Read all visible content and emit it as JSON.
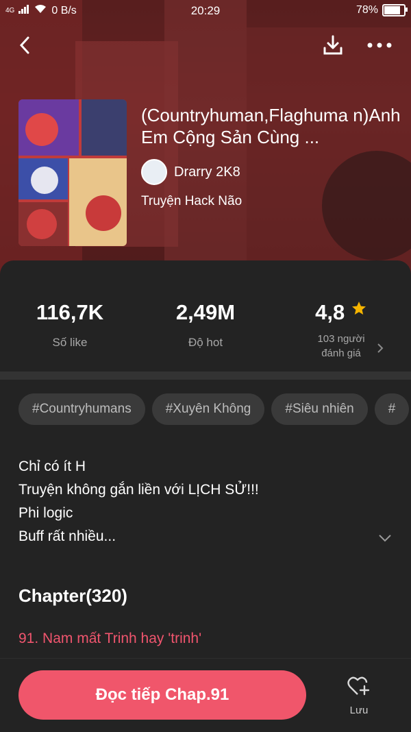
{
  "status_bar": {
    "network": "4G",
    "speed": "0 B/s",
    "time": "20:29",
    "battery": "78%"
  },
  "comic": {
    "title": "(Countryhuman,Flaghuma n)Anh Em Cộng Sản Cùng ...",
    "author": "Drarry 2K8",
    "genre": "Truyện Hack Não"
  },
  "stats": {
    "likes": {
      "value": "116,7K",
      "label": "Số like"
    },
    "hot": {
      "value": "2,49M",
      "label": "Độ hot"
    },
    "rating": {
      "value": "4,8",
      "label_line1": "103 người",
      "label_line2": "đánh giá"
    }
  },
  "tags": [
    "#Countryhumans",
    "#Xuyên Không",
    "#Siêu nhiên",
    "#"
  ],
  "description": [
    "Chỉ có ít H",
    "Truyện không gắn liền với LỊCH SỬ!!!",
    "Phi logic",
    "Buff rất nhiều..."
  ],
  "chapters": {
    "heading": "Chapter(320)",
    "latest": "91. Nam mất Trinh hay 'trinh'"
  },
  "bottom": {
    "read_label": "Đọc tiếp Chap.91",
    "save_label": "Lưu"
  },
  "colors": {
    "accent": "#f0566b",
    "star": "#f5b400",
    "panel": "#232323"
  }
}
